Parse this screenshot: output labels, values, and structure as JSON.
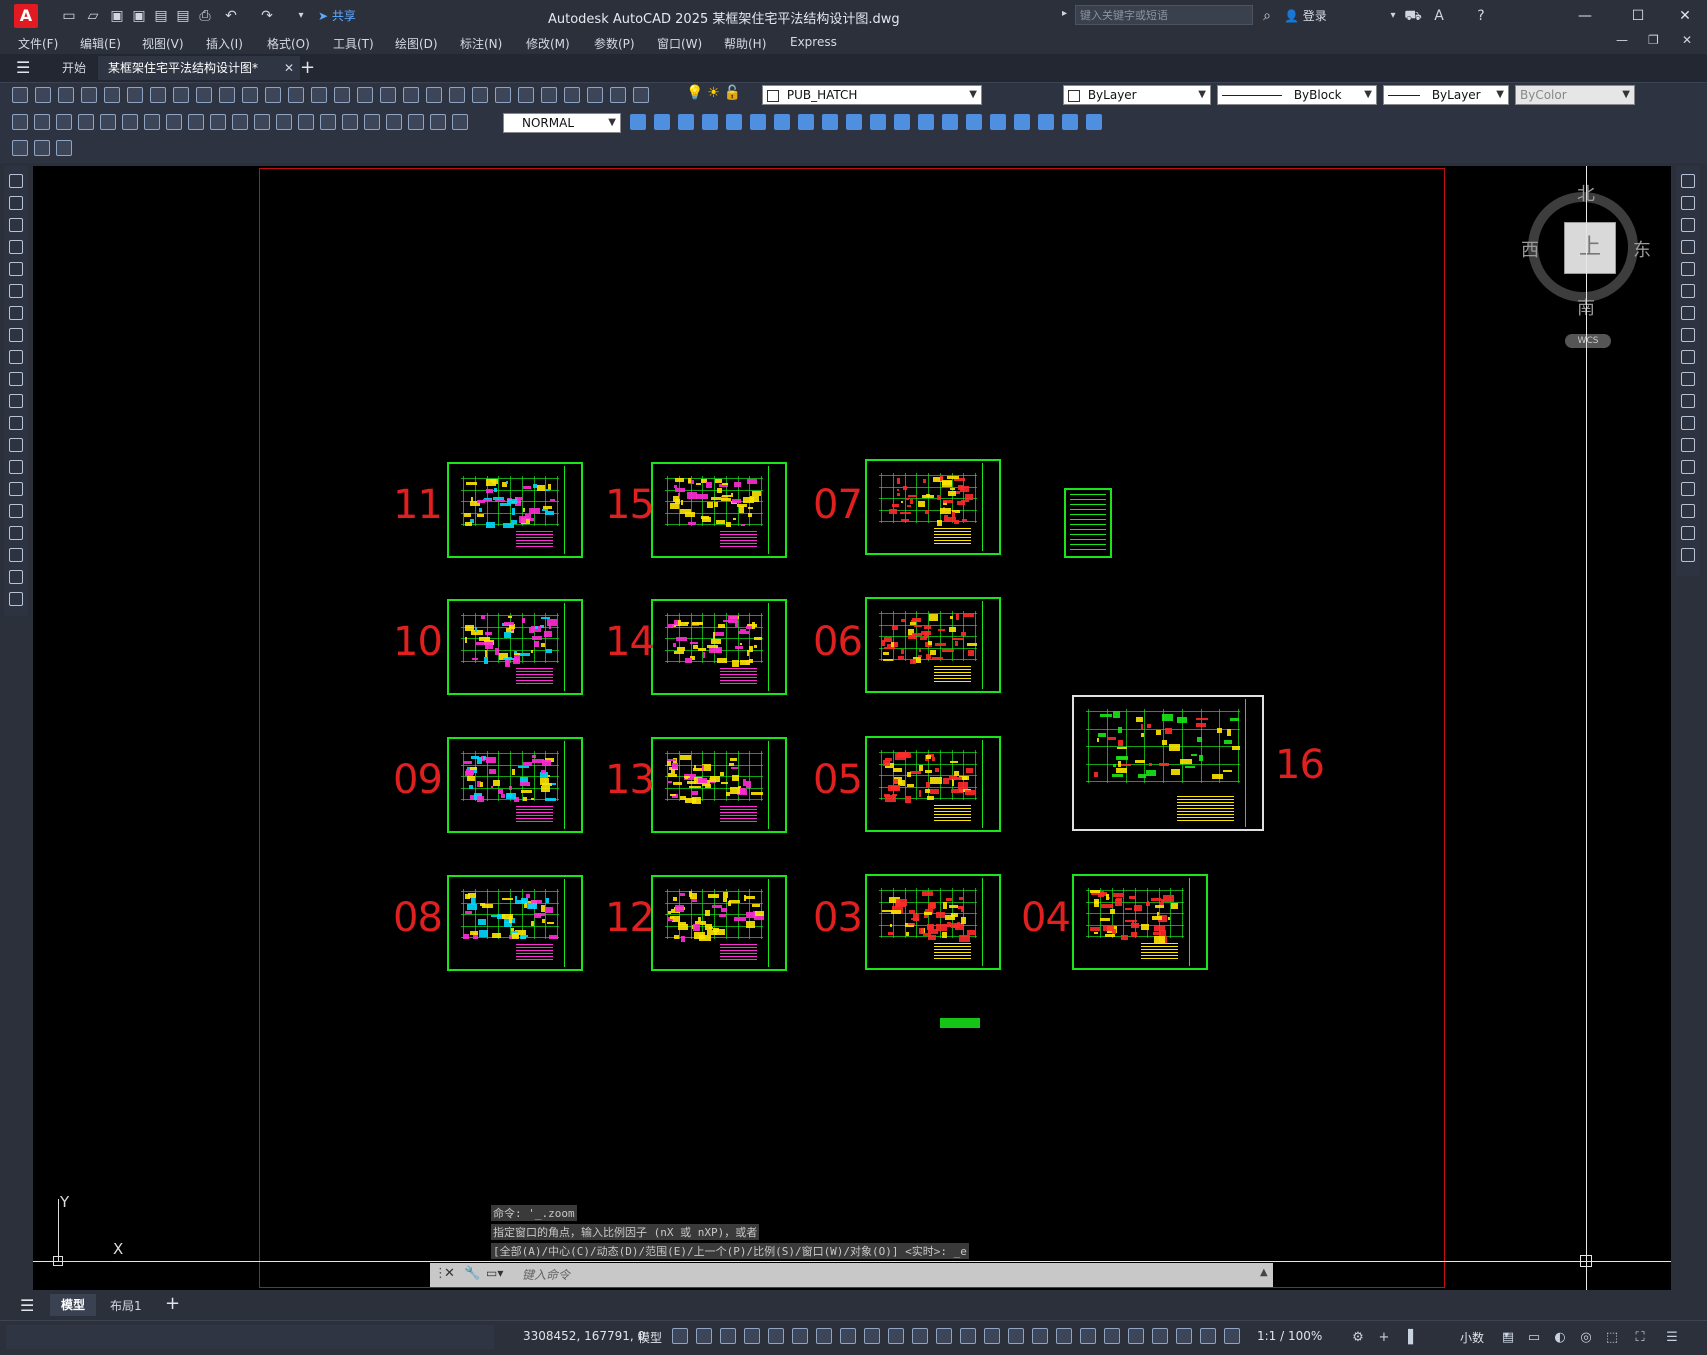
{
  "titlebar": {
    "logo": "A",
    "share_label": "共享",
    "title": "Autodesk AutoCAD 2025    某框架住宅平法结构设计图.dwg",
    "search_placeholder": "键入关键字或短语",
    "login_label": "登录"
  },
  "menus": [
    "文件(F)",
    "编辑(E)",
    "视图(V)",
    "插入(I)",
    "格式(O)",
    "工具(T)",
    "绘图(D)",
    "标注(N)",
    "修改(M)",
    "参数(P)",
    "窗口(W)",
    "帮助(H)",
    "Express"
  ],
  "tabs": {
    "start": "开始",
    "drawing": "某框架住宅平法结构设计图*",
    "add": "+"
  },
  "toolbar": {
    "layer": "PUB_HATCH",
    "color": "ByLayer",
    "linetype": "ByBlock",
    "lineweight": "ByLayer",
    "plotstyle": "ByColor",
    "dimstyle": "NORMAL"
  },
  "viewcube": {
    "north": "北",
    "south": "南",
    "east": "东",
    "west": "西",
    "face": "上",
    "wcs": "WCS"
  },
  "ucs": {
    "x": "X",
    "y": "Y"
  },
  "sheets": [
    {
      "label": "11",
      "style": "arch"
    },
    {
      "label": "15",
      "style": "yellow"
    },
    {
      "label": "07",
      "style": "red"
    },
    {
      "label": "10",
      "style": "arch"
    },
    {
      "label": "14",
      "style": "yellow"
    },
    {
      "label": "06",
      "style": "red"
    },
    {
      "label": "09",
      "style": "arch"
    },
    {
      "label": "13",
      "style": "yellow"
    },
    {
      "label": "05",
      "style": "red"
    },
    {
      "label": "08",
      "style": "arch"
    },
    {
      "label": "12",
      "style": "yellow"
    },
    {
      "label": "03",
      "style": "red"
    },
    {
      "label": "04",
      "style": "red"
    },
    {
      "label": "16",
      "style": "detail"
    }
  ],
  "command": {
    "history": [
      "命令: '_.zoom",
      "指定窗口的角点，输入比例因子 (nX 或 nXP)，或者",
      "[全部(A)/中心(C)/动态(D)/范围(E)/上一个(P)/比例(S)/窗口(W)/对象(O)] <实时>: _e"
    ],
    "placeholder": "键入命令"
  },
  "layouts": {
    "model": "模型",
    "layout1": "布局1",
    "add": "+"
  },
  "status": {
    "coords": "3308452, 167791, 0",
    "space": "模型",
    "scale": "1:1 / 100%",
    "units": "小数"
  },
  "colors": {
    "sheet_border": "#19e619",
    "label": "#e01f1f",
    "canvas": "#000000"
  }
}
